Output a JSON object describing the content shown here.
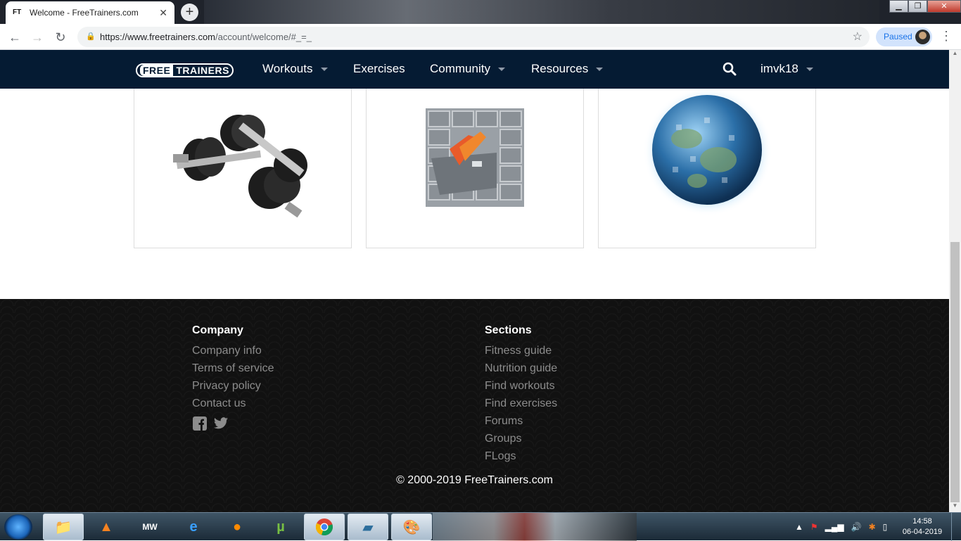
{
  "browser": {
    "tab_title": "Welcome - FreeTrainers.com",
    "tab_favicon": "FT",
    "url_host": "https://www.freetrainers.com",
    "url_path": "/account/welcome/#_=_",
    "profile_status": "Paused"
  },
  "site": {
    "logo_free": "FREE",
    "logo_trainers": "TRAINERS",
    "nav": {
      "workouts": "Workouts",
      "exercises": "Exercises",
      "community": "Community",
      "resources": "Resources",
      "user": "imvk18"
    }
  },
  "footer": {
    "company_heading": "Company",
    "company_links": [
      "Company info",
      "Terms of service",
      "Privacy policy",
      "Contact us"
    ],
    "sections_heading": "Sections",
    "sections_links": [
      "Fitness guide",
      "Nutrition guide",
      "Find workouts",
      "Find exercises",
      "Forums",
      "Groups",
      "FLogs"
    ],
    "copyright": "© 2000-2019 FreeTrainers.com"
  },
  "taskbar": {
    "time": "14:58",
    "date": "06-04-2019"
  },
  "colors": {
    "nav_bg": "#051b33",
    "footer_bg": "#111111",
    "footer_link": "#8c8c8c",
    "accent_blue": "#1a73e8"
  }
}
